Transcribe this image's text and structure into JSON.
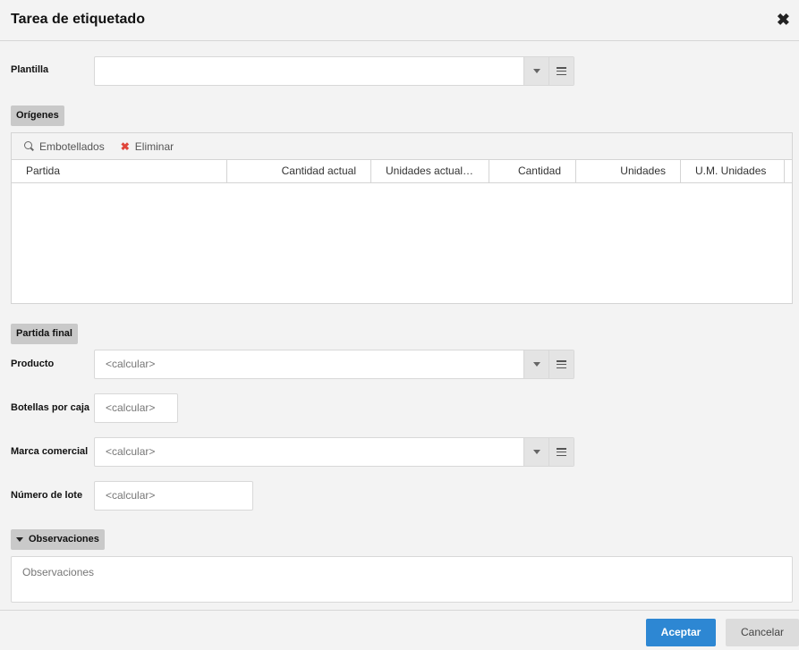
{
  "dialog": {
    "title": "Tarea de etiquetado",
    "close_icon": "close-icon"
  },
  "template": {
    "label": "Plantilla",
    "value": ""
  },
  "origins": {
    "section_label": "Orígenes",
    "toolbar": {
      "bottled_label": "Embotellados",
      "bottled_icon": "search-icon",
      "delete_label": "Eliminar",
      "delete_icon": "close-icon"
    },
    "columns": [
      "Partida",
      "Cantidad actual",
      "Unidades actual…",
      "Cantidad",
      "Unidades",
      "U.M. Unidades"
    ],
    "rows": []
  },
  "final_lot": {
    "section_label": "Partida final",
    "product": {
      "label": "Producto",
      "placeholder": "<calcular>"
    },
    "bottles_per_box": {
      "label": "Botellas por caja",
      "placeholder": "<calcular>"
    },
    "brand": {
      "label": "Marca comercial",
      "placeholder": "<calcular>"
    },
    "lot_number": {
      "label": "Número de lote",
      "placeholder": "<calcular>"
    }
  },
  "observations": {
    "section_label": "Observaciones",
    "placeholder": "Observaciones"
  },
  "footer": {
    "accept_label": "Aceptar",
    "cancel_label": "Cancelar"
  },
  "colors": {
    "primary": "#2d87d3",
    "delete": "#e0453a"
  }
}
